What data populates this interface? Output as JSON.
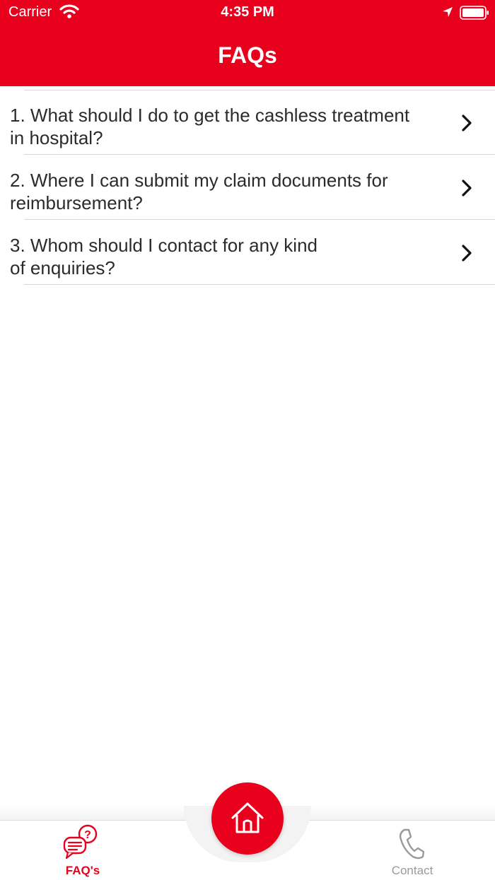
{
  "status_bar": {
    "carrier": "Carrier",
    "time": "4:35 PM"
  },
  "header": {
    "title": "FAQs"
  },
  "faqs": [
    {
      "question": "1. What should I do to get the cashless treatment\nin hospital?"
    },
    {
      "question": "2. Where I can submit my claim documents for\nreimbursement?"
    },
    {
      "question": "3. Whom should I contact for any kind\nof enquiries?"
    }
  ],
  "tabbar": {
    "faq_label": "FAQ's",
    "contact_label": "Contact"
  },
  "colors": {
    "brand": "#e8001c",
    "text": "#2b2b2b",
    "inactive": "#9a9a9a"
  }
}
